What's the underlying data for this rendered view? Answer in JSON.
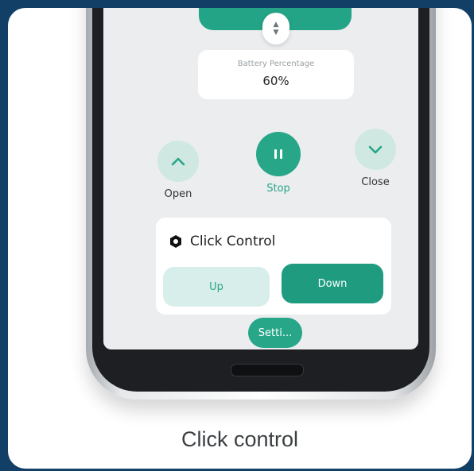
{
  "battery": {
    "label": "Battery Percentage",
    "value": "60%"
  },
  "stepper": {
    "up_glyph": "▲",
    "down_glyph": "▼"
  },
  "controls": {
    "open_label": "Open",
    "stop_label": "Stop",
    "close_label": "Close"
  },
  "click_control": {
    "title": "Click Control",
    "up_label": "Up",
    "down_label": "Down"
  },
  "settings_label": "Setti...",
  "caption": "Click control",
  "colors": {
    "accent": "#27a688",
    "accent_dark": "#1f9c80",
    "accent_light": "#d8eeea",
    "frame_background": "#123f66",
    "screen_background": "#ebedef"
  },
  "icons": [
    "chevron-up-icon",
    "pause-icon",
    "chevron-down-icon",
    "gear-hex-icon",
    "stepper-arrows-icon"
  ]
}
